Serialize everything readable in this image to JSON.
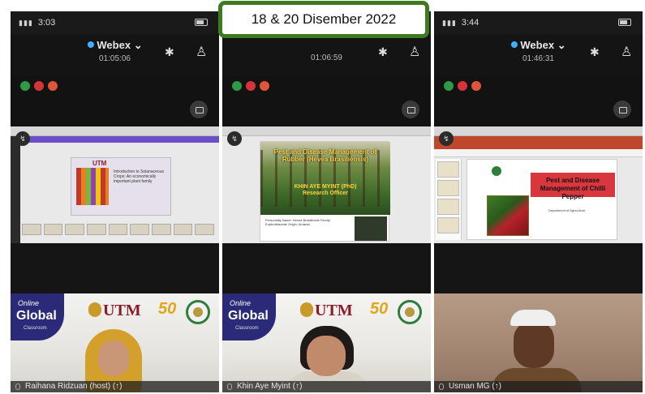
{
  "banner": {
    "date_text": "18 & 20 Disember 2022"
  },
  "panels": [
    {
      "status_time": "3:03",
      "app_name": "Webex",
      "meeting_timer": "01:05:06",
      "slide": {
        "title": "Introduction to Solanaceous Crops: An economically important plant family",
        "logo_text": "UTM"
      },
      "video": {
        "participant_label": "Raihana Ridzuan (host) (↑)",
        "badge_top": "Online",
        "badge_main": "Global",
        "badge_bottom": "Classroom",
        "utm_text": "UTM",
        "anniv_text": "50"
      }
    },
    {
      "status_time": "",
      "app_name": "",
      "meeting_timer": "01:06:59",
      "slide": {
        "title": "Pest and Disease Management of Rubber (Hevea Brasiliensis)",
        "author": "KHIN AYE MYINT (PhD)",
        "author_role": "Research Officer",
        "info_lines": "Personality Name: Hevea Brasiliensis  Family: Euphorbiaceae  Origin: Amazon"
      },
      "video": {
        "participant_label": "Khin Aye Myint (↑)",
        "badge_top": "Online",
        "badge_main": "Global",
        "badge_bottom": "Classroom",
        "utm_text": "UTM",
        "anniv_text": "50"
      }
    },
    {
      "status_time": "3:44",
      "app_name": "Webex",
      "meeting_timer": "01:46:31",
      "slide": {
        "title": "Pest and Disease Management of Chilli Pepper",
        "subtitle": "Department of Agriculture"
      },
      "video": {
        "participant_label": "Usman MG (↑)"
      }
    }
  ],
  "colors": {
    "banner_border": "#3e7a1f",
    "status_green": "#2e9a46",
    "status_red": "#d6333a",
    "status_orange": "#e0553a",
    "webex_blue": "#3fb0ff",
    "utm_maroon": "#8a1c2a"
  },
  "icons": [
    "bluetooth-icon",
    "participants-icon",
    "chevron-down-icon",
    "chat-icon",
    "pin-icon",
    "mic-icon",
    "battery-icon"
  ]
}
